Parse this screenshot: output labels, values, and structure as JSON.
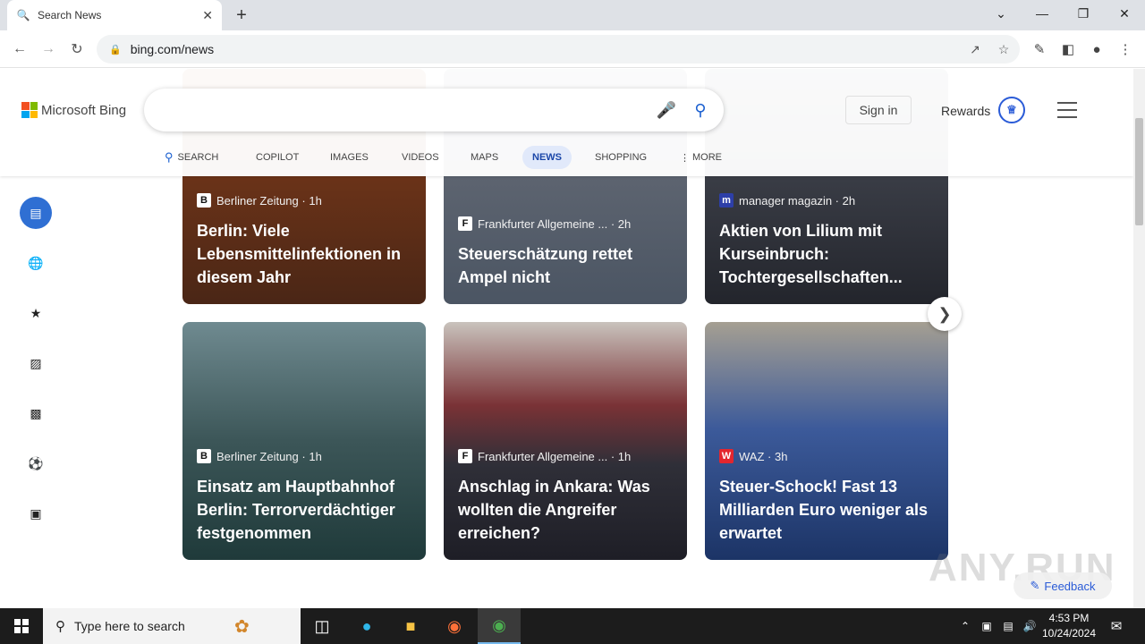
{
  "browser": {
    "tab_title": "Search News",
    "url": "bing.com/news"
  },
  "bing": {
    "logo_text": "Microsoft Bing",
    "signin": "Sign in",
    "rewards": "Rewards",
    "scopes": [
      {
        "label": "SEARCH",
        "active": false
      },
      {
        "label": "COPILOT",
        "active": false
      },
      {
        "label": "IMAGES",
        "active": false
      },
      {
        "label": "VIDEOS",
        "active": false
      },
      {
        "label": "MAPS",
        "active": false
      },
      {
        "label": "NEWS",
        "active": true
      },
      {
        "label": "SHOPPING",
        "active": false
      },
      {
        "label": "MORE",
        "active": false
      }
    ],
    "side_icons": [
      "news-icon",
      "globe-icon",
      "star-icon",
      "briefcase-icon",
      "clapperboard-icon",
      "sports-icon",
      "tech-icon"
    ]
  },
  "cards": [
    {
      "source": "Berliner Zeitung",
      "age": "1h",
      "headline": "Berlin: Viele Lebensmittelinfektionen in diesem Jahr",
      "color": "#4a2616"
    },
    {
      "source": "Frankfurter Allgemeine ...",
      "age": "2h",
      "headline": "Steuerschätzung rettet Ampel nicht",
      "color": "#4b5563"
    },
    {
      "source": "manager magazin",
      "age": "2h",
      "headline": "Aktien von Lilium mit Kurseinbruch: Tochtergesellschaften...",
      "color": "#23252c"
    },
    {
      "source": "Berliner Zeitung",
      "age": "1h",
      "headline": "Einsatz am Hauptbahnhof Berlin: Terrorverdächtiger festgenommen",
      "color": "#1f3a3a"
    },
    {
      "source": "Frankfurter Allgemeine ...",
      "age": "1h",
      "headline": "Anschlag in Ankara: Was wollten die Angreifer erreichen?",
      "color": "#1e1e26"
    },
    {
      "source": "WAZ",
      "age": "3h",
      "headline": "Steuer-Schock! Fast 13 Milliarden Euro weniger als erwartet",
      "color": "#1c3466"
    }
  ],
  "feedback": "Feedback",
  "watermark": "ANY.RUN",
  "taskbar": {
    "search_placeholder": "Type here to search",
    "time": "4:53 PM",
    "date": "10/24/2024"
  }
}
